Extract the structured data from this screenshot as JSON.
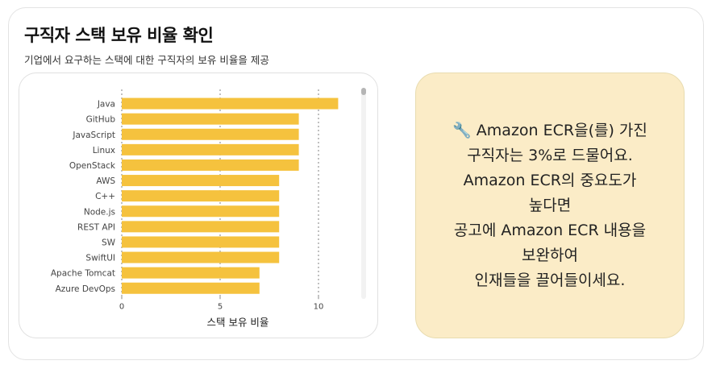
{
  "header": {
    "title": "구직자 스택 보유 비율 확인",
    "subtitle": "기업에서 요구하는 스택에 대한 구직자의 보유 비율을 제공"
  },
  "info": {
    "icon": "wrench-icon",
    "message": "🔧 Amazon ECR을(를) 가진\n구직자는 3%로 드물어요.\nAmazon ECR의 중요도가\n높다면\n공고에 Amazon ECR 내용을\n보완하여\n인재들을 끌어들이세요."
  },
  "colors": {
    "bar": "#f5c23e",
    "info_bg": "#fbecc7"
  },
  "chart_data": {
    "type": "bar",
    "orientation": "horizontal",
    "categories": [
      "Java",
      "GitHub",
      "JavaScript",
      "Linux",
      "OpenStack",
      "AWS",
      "C++",
      "Node.js",
      "REST API",
      "SW",
      "SwiftUI",
      "Apache Tomcat",
      "Azure DevOps"
    ],
    "values": [
      11,
      9,
      9,
      9,
      9,
      8,
      8,
      8,
      8,
      8,
      8,
      7,
      7
    ],
    "xlabel": "스택 보유 비율",
    "ylabel": "",
    "xlim": [
      0,
      12
    ],
    "xticks": [
      0,
      5,
      10
    ],
    "grid": "vertical dotted"
  }
}
